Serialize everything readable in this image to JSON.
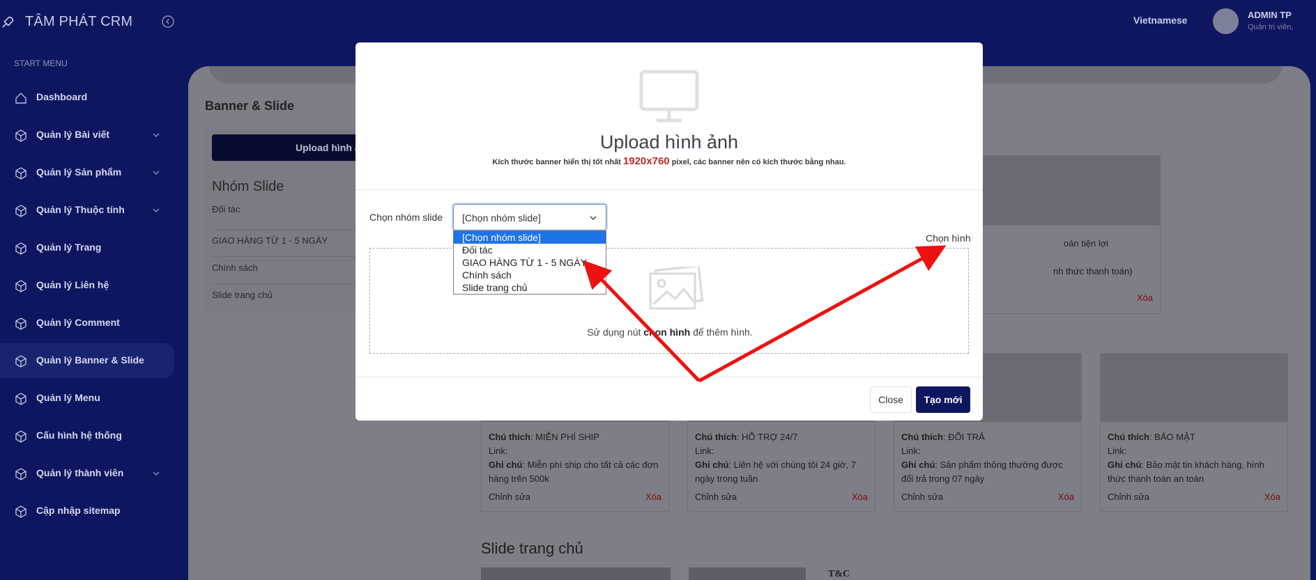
{
  "app": {
    "brand": "TÂM PHÁT CRM",
    "language": "Vietnamese",
    "user_name": "ADMIN TP",
    "user_role": "Quản trị viên,"
  },
  "sidebar": {
    "section_label": "START MENU",
    "items": [
      {
        "label": "Dashboard",
        "icon": "home-icon",
        "has_children": false,
        "active": false
      },
      {
        "label": "Quản lý Bài viết",
        "icon": "box-icon",
        "has_children": true,
        "active": false
      },
      {
        "label": "Quản lý Sản phẩm",
        "icon": "box-icon",
        "has_children": true,
        "active": false
      },
      {
        "label": "Quản lý Thuộc tính",
        "icon": "box-icon",
        "has_children": true,
        "active": false
      },
      {
        "label": "Quản lý Trang",
        "icon": "box-icon",
        "has_children": false,
        "active": false
      },
      {
        "label": "Quản lý Liên hệ",
        "icon": "box-icon",
        "has_children": false,
        "active": false
      },
      {
        "label": "Quản lý Comment",
        "icon": "box-icon",
        "has_children": false,
        "active": false
      },
      {
        "label": "Quản lý Banner & Slide",
        "icon": "box-icon",
        "has_children": false,
        "active": true
      },
      {
        "label": "Quản lý Menu",
        "icon": "box-icon",
        "has_children": false,
        "active": false
      },
      {
        "label": "Cấu hình hệ thống",
        "icon": "box-icon",
        "has_children": false,
        "active": false
      },
      {
        "label": "Quản lý thành viên",
        "icon": "box-icon",
        "has_children": true,
        "active": false
      },
      {
        "label": "Cập nhập sitemap",
        "icon": "box-icon",
        "has_children": false,
        "active": false
      }
    ]
  },
  "page": {
    "title": "Banner & Slide",
    "upload_button": "Upload hình ả",
    "group_title": "Nhóm Slide",
    "groups": [
      "Đối tác",
      "GIAO HÀNG TỪ 1 - 5 NGÀY",
      "Chính sách",
      "Slide trang chủ"
    ],
    "partial_card": {
      "line1": "oán tiện lợi",
      "line2": "nh thức thanh toán)",
      "delete": "Xóa"
    },
    "cards": [
      {
        "caption_label": "Chú thích",
        "caption": "MIỄN PHÍ SHIP",
        "link_label": "Link",
        "note_label": "Ghi chú",
        "note": "Miễn phí ship cho tất cả các đơn hàng trên 500k",
        "edit": "Chỉnh sửa",
        "delete": "Xóa"
      },
      {
        "caption_label": "Chú thích",
        "caption": "HỖ TRỢ 24/7",
        "link_label": "Link",
        "note_label": "Ghi chú",
        "note": "Liên hệ với chúng tôi 24 giờ, 7 ngày trong tuần",
        "edit": "Chỉnh sửa",
        "delete": "Xóa"
      },
      {
        "caption_label": "Chú thích",
        "caption": "ĐỔI TRẢ",
        "link_label": "Link",
        "note_label": "Ghi chú",
        "note": "Sản phẩm thông thường được đổi trả trong 07 ngày",
        "edit": "Chỉnh sửa",
        "delete": "Xóa"
      },
      {
        "caption_label": "Chú thích",
        "caption": "BẢO MẬT",
        "link_label": "Link",
        "note_label": "Ghi chú",
        "note": "Bảo mật tin khách hàng, hình thức thanh toán an toàn",
        "edit": "Chỉnh sửa",
        "delete": "Xóa"
      }
    ],
    "slide_section_title": "Slide trang chủ",
    "thumb_text": "T&C"
  },
  "modal": {
    "title": "Upload hình ảnh",
    "subtitle_before": "Kích thước banner hiển thị tốt nhất",
    "subtitle_size": "1920x760",
    "subtitle_after": "pixel, các banner nên có kích thước bằng nhau.",
    "field_label": "Chọn nhóm slide",
    "select_value": "[Chọn nhóm slide]",
    "options": [
      "[Chọn nhóm slide]",
      "Đối tác",
      "GIAO HÀNG TỪ 1 - 5 NGÀY",
      "Chính sách",
      "Slide trang chủ"
    ],
    "choose_image": "Chọn hình",
    "dropzone_before": "Sử dụng nút",
    "dropzone_bold": "chọn hình",
    "dropzone_after": "để thêm hình.",
    "close_button": "Close",
    "create_button": "Tạo mới"
  },
  "colors": {
    "navy": "#0e1660",
    "select_highlight": "#1e73e8",
    "delete_red": "#c62828",
    "annotation_arrow": "#ee1111"
  }
}
